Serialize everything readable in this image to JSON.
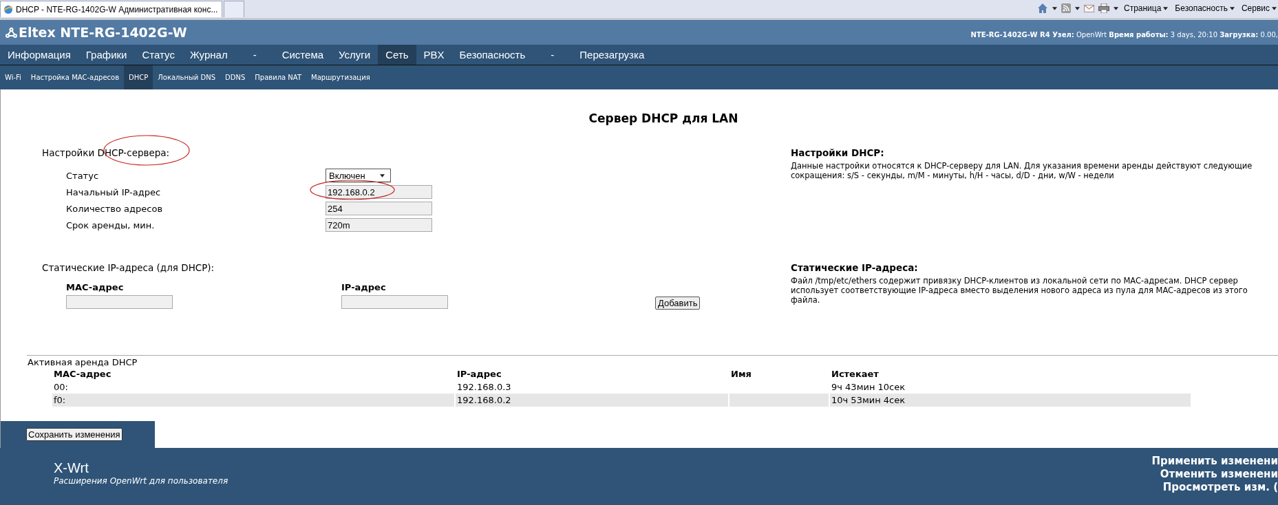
{
  "browser": {
    "tab_title": "DHCP - NTE-RG-1402G-W Административная конс...",
    "menus": [
      "Страница",
      "Безопасность",
      "Сервис"
    ]
  },
  "header": {
    "title": "Eltex NTE-RG-1402G-W",
    "status": "**NTE-RG-1402G-W R4 Узел:** OpenWrt **Время работы:** 3 days, 20:10 **Загрузка:** 0.00,"
  },
  "main_menu": [
    {
      "label": "Информация",
      "selected": false
    },
    {
      "label": "Графики",
      "selected": false
    },
    {
      "label": "Статус",
      "selected": false
    },
    {
      "label": "Журнал",
      "selected": false
    },
    {
      "label": "-",
      "selected": false
    },
    {
      "label": "Система",
      "selected": false
    },
    {
      "label": "Услуги",
      "selected": false
    },
    {
      "label": "Сеть",
      "selected": true
    },
    {
      "label": "PBX",
      "selected": false
    },
    {
      "label": "Безопасность",
      "selected": false
    },
    {
      "label": "-",
      "selected": false
    },
    {
      "label": "Перезагрузка",
      "selected": false
    }
  ],
  "sub_menu": [
    {
      "label": "Wi-Fi",
      "selected": false
    },
    {
      "label": "Настройка MAC-адресов",
      "selected": false
    },
    {
      "label": "DHCP",
      "selected": true
    },
    {
      "label": "Локальный DNS",
      "selected": false
    },
    {
      "label": "DDNS",
      "selected": false
    },
    {
      "label": "Правила NAT",
      "selected": false
    },
    {
      "label": "Маршрутизация",
      "selected": false
    }
  ],
  "page_title": "Сервер DHCP для LAN",
  "settings": {
    "heading": "Настройки DHCP-сервера:",
    "fields": [
      {
        "kind": "select",
        "label": "Статус",
        "value": "Включен"
      },
      {
        "kind": "text",
        "label": "Начальный IP-адрес",
        "value": "192.168.0.2"
      },
      {
        "kind": "text",
        "label": "Количество адресов",
        "value": "254"
      },
      {
        "kind": "text",
        "label": "Срок аренды, мин.",
        "value": "720m"
      }
    ]
  },
  "settings_help": {
    "title": "Настройки DHCP:",
    "text": "Данные настройки относятся к DHCP-серверу для LAN. Для указания времени аренды действуют следующие сокращения: s/S - секунды, m/M - минуты, h/H - часы, d/D - дни, w/W - недели"
  },
  "static": {
    "heading": "Статические IP-адреса (для DHCP):",
    "columns": [
      "MAC-адрес",
      "IP-адрес"
    ],
    "add_button": "Добавить"
  },
  "static_help": {
    "title": "Статические IP-адреса:",
    "text": "Файл /tmp/etc/ethers содержит привязку DHCP-клиентов из локальной сети по MAC-адресам. DHCP сервер использует соответствующие IP-адреса вместо выделения нового адреса из пула для MAC-адресов из этого файла."
  },
  "leases": {
    "title": "Активная аренда DHCP",
    "columns": [
      "MAC-адрес",
      "IP-адрес",
      "Имя",
      "Истекает"
    ],
    "rows": [
      {
        "mac": "00:",
        "ip": "192.168.0.3",
        "expires": "9ч 43мин 10сек"
      },
      {
        "mac": "f0:",
        "ip": "192.168.0.2",
        "expires": "10ч 53мин 4сек"
      }
    ]
  },
  "save_button": "Сохранить изменения",
  "footer": {
    "brand": "X-Wrt",
    "tagline": "Расширения OpenWrt для пользователя",
    "actions": [
      "Применить изменени",
      "Отменить изменени",
      "Просмотреть изм. ("
    ]
  }
}
